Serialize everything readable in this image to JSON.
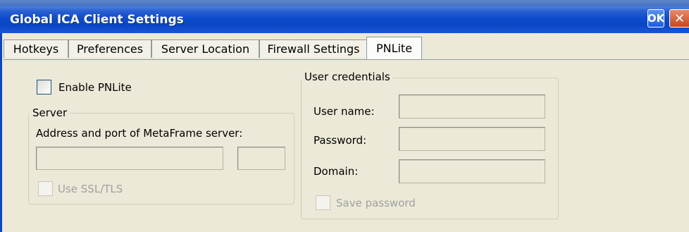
{
  "window": {
    "title": "Global ICA Client Settings",
    "ok_label": "OK",
    "close_label": "✕"
  },
  "tabs": [
    {
      "label": "Hotkeys"
    },
    {
      "label": "Preferences"
    },
    {
      "label": "Server Location"
    },
    {
      "label": "Firewall Settings"
    },
    {
      "label": "PNLite",
      "active": true
    }
  ],
  "pnlite": {
    "enable_label": "Enable PNLite",
    "enable_checked": false,
    "server": {
      "legend": "Server",
      "address_label": "Address and port of MetaFrame server:",
      "address_value": "",
      "port_value": "",
      "ssl_label": "Use SSL/TLS",
      "ssl_checked": false
    },
    "credentials": {
      "legend": "User credentials",
      "username_label": "User name:",
      "username_value": "",
      "password_label": "Password:",
      "password_value": "",
      "domain_label": "Domain:",
      "domain_value": "",
      "save_password_label": "Save password",
      "save_password_checked": false
    }
  },
  "colors": {
    "titlebar": "#0a46c4",
    "dialog_bg": "#ece9d8",
    "disabled_text": "#a0a0a0"
  }
}
